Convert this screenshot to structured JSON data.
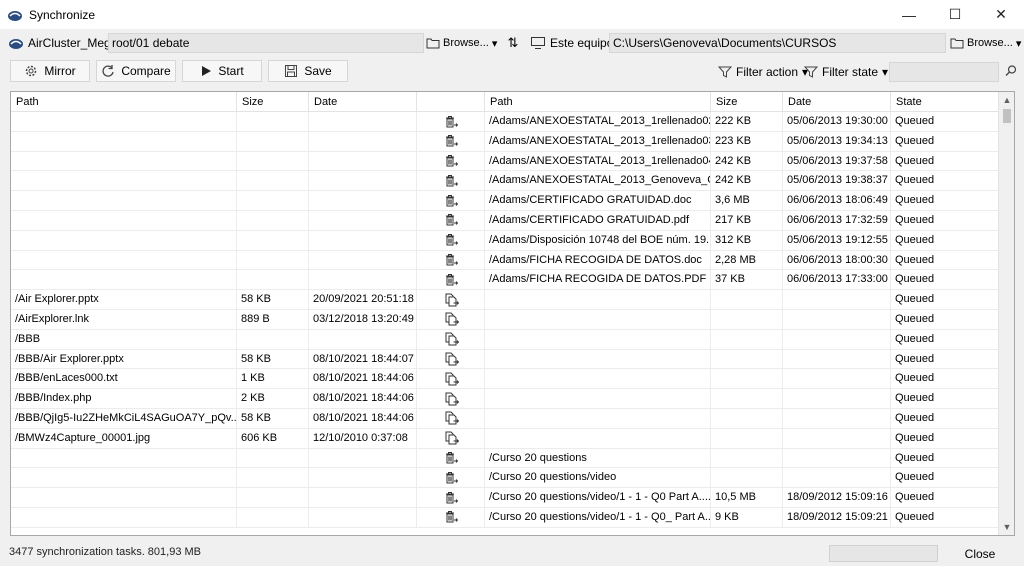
{
  "window": {
    "title": "Synchronize",
    "controls": [
      "—",
      "☐",
      "✕"
    ]
  },
  "source": {
    "account": "AirCluster_Mega",
    "path": "root/01 debate",
    "browse_label": "Browse..."
  },
  "destination": {
    "account": "Este equipo",
    "path": "C:\\Users\\Genoveva\\Documents\\CURSOS",
    "browse_label": "Browse..."
  },
  "toolbar": {
    "mirror_label": "Mirror",
    "compare_label": "Compare",
    "start_label": "Start",
    "save_label": "Save",
    "filter_action_label": "Filter action",
    "filter_state_label": "Filter state",
    "filter_search_value": ""
  },
  "table": {
    "headers": {
      "path": "Path",
      "size": "Size",
      "date": "Date",
      "rpath": "Path",
      "rsize": "Size",
      "rdate": "Date",
      "state": "State"
    },
    "rows": [
      {
        "lpath": "",
        "lsize": "",
        "ldate": "",
        "action": "delete",
        "rpath": "/Adams/ANEXOESTATAL_2013_1rellenado02....",
        "rsize": "222 KB",
        "rdate": "05/06/2013 19:30:00",
        "state": "Queued"
      },
      {
        "lpath": "",
        "lsize": "",
        "ldate": "",
        "action": "delete",
        "rpath": "/Adams/ANEXOESTATAL_2013_1rellenado03....",
        "rsize": "223 KB",
        "rdate": "05/06/2013 19:34:13",
        "state": "Queued"
      },
      {
        "lpath": "",
        "lsize": "",
        "ldate": "",
        "action": "delete",
        "rpath": "/Adams/ANEXOESTATAL_2013_1rellenado04....",
        "rsize": "242 KB",
        "rdate": "05/06/2013 19:37:58",
        "state": "Queued"
      },
      {
        "lpath": "",
        "lsize": "",
        "ldate": "",
        "action": "delete",
        "rpath": "/Adams/ANEXOESTATAL_2013_Genoveva_C...",
        "rsize": "242 KB",
        "rdate": "05/06/2013 19:38:37",
        "state": "Queued"
      },
      {
        "lpath": "",
        "lsize": "",
        "ldate": "",
        "action": "delete",
        "rpath": "/Adams/CERTIFICADO GRATUIDAD.doc",
        "rsize": "3,6 MB",
        "rdate": "06/06/2013 18:06:49",
        "state": "Queued"
      },
      {
        "lpath": "",
        "lsize": "",
        "ldate": "",
        "action": "delete",
        "rpath": "/Adams/CERTIFICADO GRATUIDAD.pdf",
        "rsize": "217 KB",
        "rdate": "06/06/2013 17:32:59",
        "state": "Queued"
      },
      {
        "lpath": "",
        "lsize": "",
        "ldate": "",
        "action": "delete",
        "rpath": "/Adams/Disposición 10748 del BOE núm. 19...",
        "rsize": "312 KB",
        "rdate": "05/06/2013 19:12:55",
        "state": "Queued"
      },
      {
        "lpath": "",
        "lsize": "",
        "ldate": "",
        "action": "delete",
        "rpath": "/Adams/FICHA RECOGIDA DE DATOS.doc",
        "rsize": "2,28 MB",
        "rdate": "06/06/2013 18:00:30",
        "state": "Queued"
      },
      {
        "lpath": "",
        "lsize": "",
        "ldate": "",
        "action": "delete",
        "rpath": "/Adams/FICHA RECOGIDA DE DATOS.PDF",
        "rsize": "37 KB",
        "rdate": "06/06/2013 17:33:00",
        "state": "Queued"
      },
      {
        "lpath": "/Air Explorer.pptx",
        "lsize": "58 KB",
        "ldate": "20/09/2021 20:51:18",
        "action": "copy",
        "rpath": "",
        "rsize": "",
        "rdate": "",
        "state": "Queued"
      },
      {
        "lpath": "/AirExplorer.lnk",
        "lsize": "889 B",
        "ldate": "03/12/2018 13:20:49",
        "action": "copy",
        "rpath": "",
        "rsize": "",
        "rdate": "",
        "state": "Queued"
      },
      {
        "lpath": "/BBB",
        "lsize": "",
        "ldate": "",
        "action": "copy",
        "rpath": "",
        "rsize": "",
        "rdate": "",
        "state": "Queued"
      },
      {
        "lpath": "/BBB/Air Explorer.pptx",
        "lsize": "58 KB",
        "ldate": "08/10/2021 18:44:07",
        "action": "copy",
        "rpath": "",
        "rsize": "",
        "rdate": "",
        "state": "Queued"
      },
      {
        "lpath": "/BBB/enLaces000.txt",
        "lsize": "1 KB",
        "ldate": "08/10/2021 18:44:06",
        "action": "copy",
        "rpath": "",
        "rsize": "",
        "rdate": "",
        "state": "Queued"
      },
      {
        "lpath": "/BBB/Index.php",
        "lsize": "2 KB",
        "ldate": "08/10/2021 18:44:06",
        "action": "copy",
        "rpath": "",
        "rsize": "",
        "rdate": "",
        "state": "Queued"
      },
      {
        "lpath": "/BBB/QjIg5-Iu2ZHeMkCiL4SAGuOA7Y_pQv...",
        "lsize": "58 KB",
        "ldate": "08/10/2021 18:44:06",
        "action": "copy",
        "rpath": "",
        "rsize": "",
        "rdate": "",
        "state": "Queued"
      },
      {
        "lpath": "/BMWz4Capture_00001.jpg",
        "lsize": "606 KB",
        "ldate": "12/10/2010 0:37:08",
        "action": "copy",
        "rpath": "",
        "rsize": "",
        "rdate": "",
        "state": "Queued"
      },
      {
        "lpath": "",
        "lsize": "",
        "ldate": "",
        "action": "delete",
        "rpath": "/Curso 20 questions",
        "rsize": "",
        "rdate": "",
        "state": "Queued"
      },
      {
        "lpath": "",
        "lsize": "",
        "ldate": "",
        "action": "delete",
        "rpath": "/Curso 20 questions/video",
        "rsize": "",
        "rdate": "",
        "state": "Queued"
      },
      {
        "lpath": "",
        "lsize": "",
        "ldate": "",
        "action": "delete",
        "rpath": "/Curso 20 questions/video/1 - 1 - Q0 Part A....",
        "rsize": "10,5 MB",
        "rdate": "18/09/2012 15:09:16",
        "state": "Queued"
      },
      {
        "lpath": "",
        "lsize": "",
        "ldate": "",
        "action": "delete",
        "rpath": "/Curso 20 questions/video/1 - 1 - Q0_ Part A....",
        "rsize": "9 KB",
        "rdate": "18/09/2012 15:09:21",
        "state": "Queued"
      }
    ]
  },
  "status": {
    "summary": "3477 synchronization tasks. 801,93 MB",
    "progress": 0,
    "close_label": "Close"
  }
}
